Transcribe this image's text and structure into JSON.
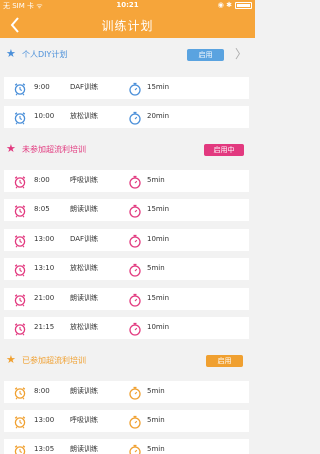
{
  "status_bar": {
    "carrier": "无 SIM 卡 ᯤ",
    "time": "10:21",
    "icons": "◉ ✱"
  },
  "nav": {
    "title": "训练计划",
    "back": "〈"
  },
  "sections": [
    {
      "title": "个人DIY计划",
      "button": "启用",
      "accent": "#4a8fd9",
      "button_color": "#5aa3e0",
      "rows": [
        {
          "time": "9:00",
          "name": "DAF训练",
          "duration": "15min"
        },
        {
          "time": "10:00",
          "name": "放松训练",
          "duration": "20min"
        }
      ]
    },
    {
      "title": "未参加超流利培训",
      "button": "启用中",
      "accent": "#e2397f",
      "button_color": "#e2397f",
      "rows": [
        {
          "time": "8:00",
          "name": "呼吸训练",
          "duration": "5min"
        },
        {
          "time": "8:05",
          "name": "朗读训练",
          "duration": "15min"
        },
        {
          "time": "13:00",
          "name": "DAF训练",
          "duration": "10min"
        },
        {
          "time": "13:10",
          "name": "放松训练",
          "duration": "5min"
        },
        {
          "time": "21:00",
          "name": "朗读训练",
          "duration": "15min"
        },
        {
          "time": "21:15",
          "name": "放松训练",
          "duration": "10min"
        }
      ]
    },
    {
      "title": "已参加超流利培训",
      "button": "启用",
      "accent": "#f0a030",
      "button_color": "#f0a030",
      "rows": [
        {
          "time": "8:00",
          "name": "朗读训练",
          "duration": "5min"
        },
        {
          "time": "13:00",
          "name": "呼吸训练",
          "duration": "5min"
        },
        {
          "time": "13:05",
          "name": "朗读训练",
          "duration": "5min"
        }
      ]
    }
  ],
  "colors": {
    "header": "#f6a53a",
    "background": "#f2f2f2",
    "text": "#333333"
  },
  "icons": {
    "row_left": "alarm-clock-icon",
    "row_right": "stopwatch-icon",
    "section": "star-icon",
    "chevron": "chevron-right-icon"
  }
}
